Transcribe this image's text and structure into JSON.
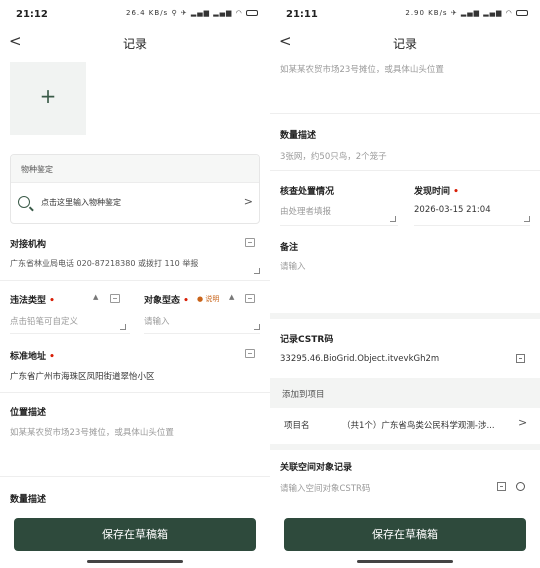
{
  "left": {
    "status": {
      "time": "21:12",
      "net": "26.4 KB/s",
      "icons": "⚲ ✈ ▂▄▆ ▂▄▆ ◠"
    },
    "nav": {
      "back": "<",
      "title": "记录"
    },
    "photo": {
      "plus": "+"
    },
    "species": {
      "header": "物种鉴定",
      "placeholder": "点击这里输入物种鉴定",
      "chev": ">"
    },
    "agency": {
      "label": "对接机构",
      "value": "广东省林业局电话 020-87218380 或拨打 110 举报"
    },
    "violation": {
      "label": "违法类型",
      "required": "•",
      "placeholder": "点击铅笔可自定义"
    },
    "object_state": {
      "label": "对象型态",
      "required": "•",
      "note": "● 说明",
      "placeholder": "请输入"
    },
    "std_address": {
      "label": "标准地址",
      "required": "•",
      "value": "广东省广州市海珠区凤阳街道翠怡小区"
    },
    "location": {
      "label": "位置描述",
      "placeholder": "如某某农贸市场23号摊位，或具体山头位置"
    },
    "quantity": {
      "label": "数量描述"
    },
    "save": "保存在草稿箱"
  },
  "right": {
    "status": {
      "time": "21:11",
      "net": "2.90 KB/s",
      "icons": "✈ ▂▄▆ ▂▄▆ ◠"
    },
    "nav": {
      "back": "<",
      "title": "记录"
    },
    "location_placeholder": "如某某农贸市场23号摊位，或具体山头位置",
    "quantity": {
      "label": "数量描述",
      "placeholder": "3张网，约50只鸟，2个笼子"
    },
    "check": {
      "label": "核查处置情况",
      "placeholder": "由处理者填报"
    },
    "found_time": {
      "label": "发现时间",
      "required": "•",
      "value": "2026-03-15 21:04"
    },
    "remark": {
      "label": "备注",
      "placeholder": "请输入"
    },
    "cstr": {
      "label": "记录CSTR码",
      "value": "33295.46.BioGrid.Object.itvevkGh2m"
    },
    "project": {
      "header": "添加到项目",
      "label": "项目名",
      "value": "（共1个）广东省鸟类公民科学观测-涉...",
      "chev": ">"
    },
    "spatial": {
      "label": "关联空间对象记录",
      "placeholder": "请输入空间对象CSTR码"
    },
    "save": "保存在草稿箱"
  }
}
